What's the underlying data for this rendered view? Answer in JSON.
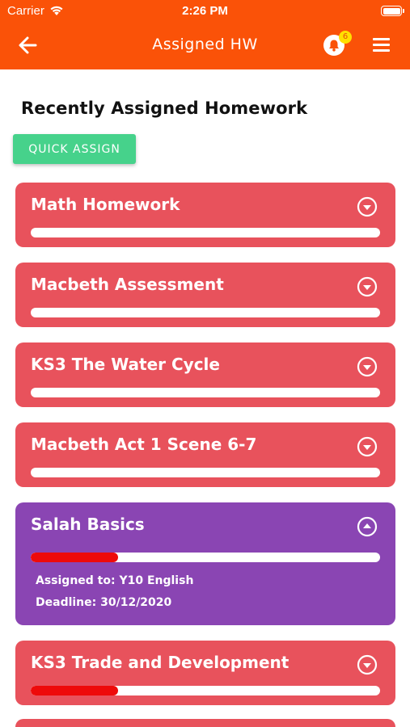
{
  "status_bar": {
    "carrier": "Carrier",
    "time": "2:26 PM",
    "icons": [
      "wifi-icon",
      "battery-icon"
    ]
  },
  "nav": {
    "title": "Assigned HW",
    "back_icon": "arrow-left-icon",
    "bell_icon": "bell-icon",
    "notification_count": "6",
    "menu_icon": "hamburger-menu-icon"
  },
  "section": {
    "title": "Recently Assigned Homework",
    "quick_assign_label": "QUICK ASSIGN"
  },
  "homework": [
    {
      "title": "Math Homework",
      "expanded": false,
      "progress": 0,
      "color": "#e8525c"
    },
    {
      "title": "Macbeth Assessment",
      "expanded": false,
      "progress": 0,
      "color": "#e8525c"
    },
    {
      "title": "KS3 The Water Cycle",
      "expanded": false,
      "progress": 0,
      "color": "#e8525c"
    },
    {
      "title": "Macbeth Act 1 Scene 6-7",
      "expanded": false,
      "progress": 0,
      "color": "#e8525c"
    },
    {
      "title": "Salah Basics",
      "expanded": true,
      "progress": 0.25,
      "color": "#8a45b3",
      "assigned_to": "Assigned to: Y10 English",
      "deadline": "Deadline: 30/12/2020"
    },
    {
      "title": "KS3 Trade and Development",
      "expanded": false,
      "progress": 0.25,
      "color": "#e8525c"
    }
  ],
  "colors": {
    "header": "#fa5208",
    "quick_assign": "#46d28b",
    "progress_fill": "#ee0a0a",
    "badge": "#ffe000"
  }
}
